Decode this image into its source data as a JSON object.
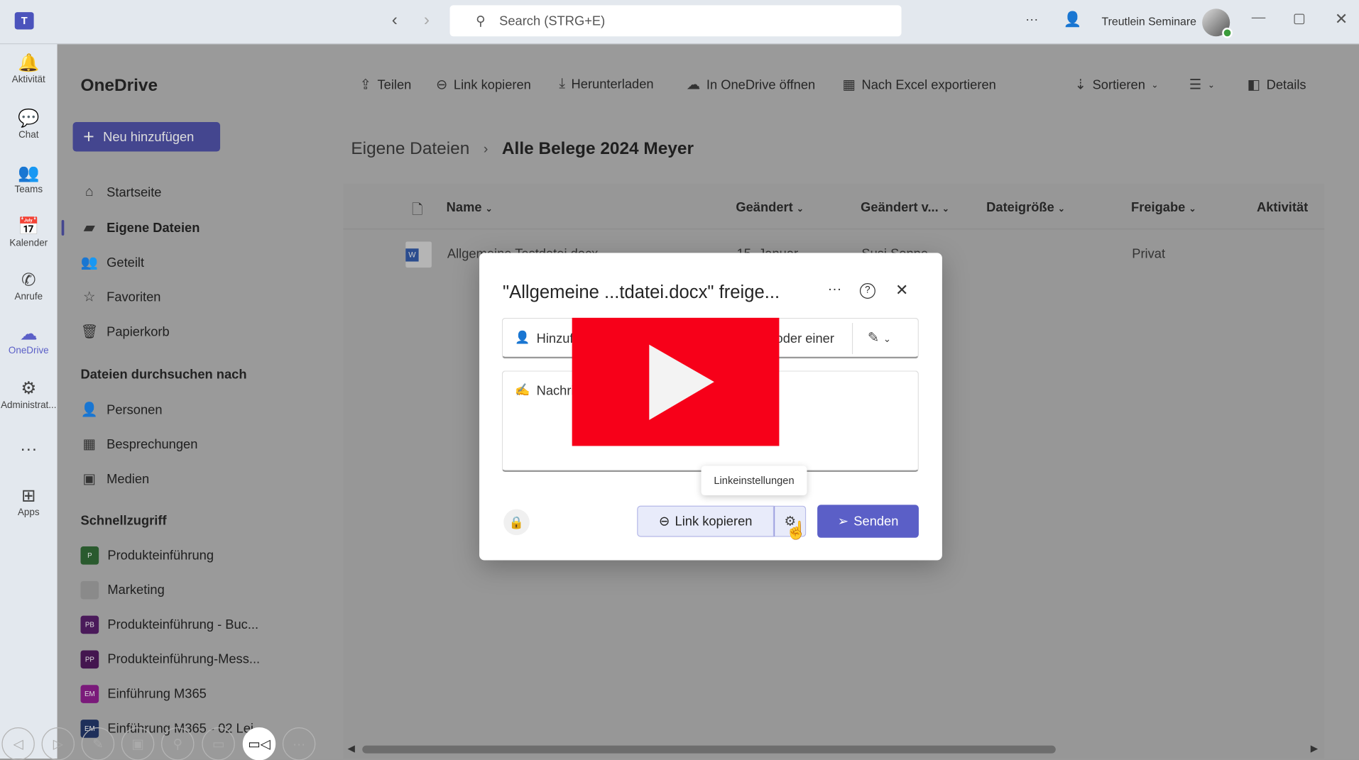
{
  "titlebar": {
    "search_placeholder": "Search (STRG+E)",
    "user_name": "Treutlein Seminare",
    "more": "···"
  },
  "rail": [
    {
      "label": "Aktivität",
      "icon": "bell-icon",
      "glyph": "🔔"
    },
    {
      "label": "Chat",
      "icon": "chat-icon",
      "glyph": "💬"
    },
    {
      "label": "Teams",
      "icon": "teams-icon",
      "glyph": "👥"
    },
    {
      "label": "Kalender",
      "icon": "calendar-icon",
      "glyph": "📅"
    },
    {
      "label": "Anrufe",
      "icon": "phone-icon",
      "glyph": "✆"
    },
    {
      "label": "OneDrive",
      "icon": "cloud-icon",
      "glyph": "☁"
    },
    {
      "label": "Administrat...",
      "icon": "admin-icon",
      "glyph": "⚙"
    },
    {
      "label": "",
      "icon": "more-icon",
      "glyph": "···"
    },
    {
      "label": "Apps",
      "icon": "add-apps-icon",
      "glyph": "⊞"
    }
  ],
  "sidebar": {
    "title": "OneDrive",
    "new_button": "Neu hinzufügen",
    "items": [
      {
        "label": "Startseite",
        "glyph": "⌂"
      },
      {
        "label": "Eigene Dateien",
        "glyph": "▰"
      },
      {
        "label": "Geteilt",
        "glyph": "👥"
      },
      {
        "label": "Favoriten",
        "glyph": "☆"
      },
      {
        "label": "Papierkorb",
        "glyph": "🗑"
      }
    ],
    "browse_title": "Dateien durchsuchen nach",
    "browse": [
      {
        "label": "Personen",
        "glyph": "👤"
      },
      {
        "label": "Besprechungen",
        "glyph": "▦"
      },
      {
        "label": "Medien",
        "glyph": "▣"
      }
    ],
    "quick_title": "Schnellzugriff",
    "quick": [
      {
        "label": "Produkteinführung",
        "abbr": "P",
        "color": "#2a5a2e"
      },
      {
        "label": "Marketing",
        "abbr": "",
        "color": "#8a8a8a"
      },
      {
        "label": "Produkteinführung - Buc...",
        "abbr": "PB",
        "color": "#4a1a5a"
      },
      {
        "label": "Produkteinführung-Mess...",
        "abbr": "PP",
        "color": "#44154f"
      },
      {
        "label": "Einführung M365",
        "abbr": "EM",
        "color": "#7a1a7a"
      },
      {
        "label": "Einführung M365 - 02 Lei...",
        "abbr": "EM",
        "color": "#1e2f5a"
      }
    ]
  },
  "toolbar": {
    "share": "Teilen",
    "copy_link": "Link kopieren",
    "download": "Herunterladen",
    "open_onedrive": "In OneDrive öffnen",
    "export_excel": "Nach Excel exportieren",
    "sort": "Sortieren",
    "details": "Details"
  },
  "breadcrumb": {
    "root": "Eigene Dateien",
    "current": "Alle Belege 2024 Meyer"
  },
  "table": {
    "columns": [
      "Name",
      "Geändert",
      "Geändert v...",
      "Dateigröße",
      "Freigabe",
      "Aktivität"
    ],
    "rows": [
      {
        "name": "Allgemeine Testdatei.docx",
        "modified": "15. Januar",
        "modified_by": "Susi Sonne",
        "sharing": "Privat"
      }
    ]
  },
  "dialog": {
    "title": "\"Allgemeine ...tdatei.docx\" freige...",
    "people_placeholder": "Hinzufügen eines Namens, einer Gruppe oder einer",
    "message_placeholder": "Nachricht hinzufügen",
    "tooltip": "Linkeinstellungen",
    "copy_link": "Link kopieren",
    "send": "Senden",
    "accent": "#5b5fc7"
  },
  "video_overlay": {
    "color": "#f70019"
  }
}
